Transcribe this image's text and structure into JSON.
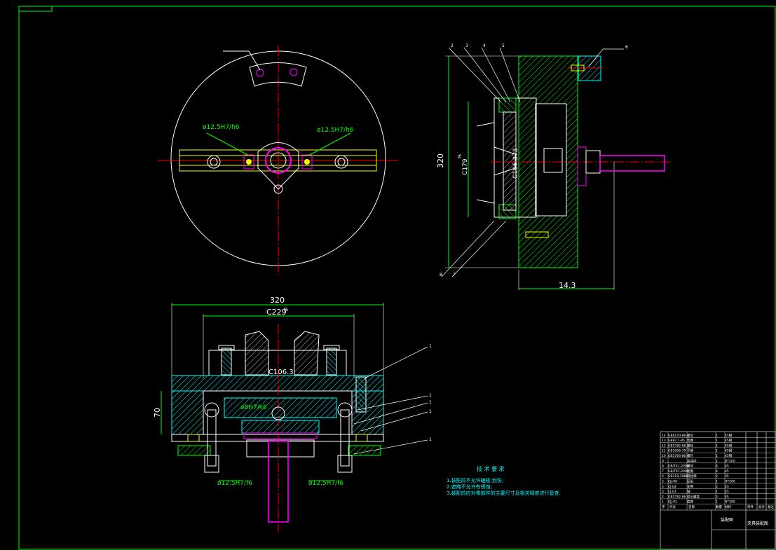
{
  "drawing": {
    "top_view": {
      "fit_left": "ø12.5H7/h6",
      "fit_right": "ø12.5H7/h6"
    },
    "side_view": {
      "overall_height": "320",
      "depth": "14.3",
      "dim_c179": "C179",
      "dim_c179_sub": "f6",
      "dim_c106": "C106.373",
      "balloons": [
        "2",
        "3",
        "4",
        "5",
        "6",
        "7",
        "8"
      ]
    },
    "front_view": {
      "overall_width": "320",
      "dim_c229": "C229",
      "dim_c229_sub": "f6",
      "dim_c106": "C106.3",
      "height": "70",
      "fit_center": "ø8H7/k6",
      "fit_left": "ø12.5H7/f6",
      "fit_right": "ø12.5H7/f6",
      "balloons": [
        "1",
        "1",
        "1",
        "1",
        "1"
      ]
    },
    "tech_requirements": {
      "title": "技 术 要 求",
      "items": [
        "1.装配前不允许磕碰,划伤;",
        "2.遮掩不允许有锈蚀;",
        "3.装配前应对零部件的主要尺寸及相关精度进行复查."
      ]
    },
    "title_block": {
      "drawing_name": "装配图",
      "part_name": "夹具装配图",
      "header": [
        "序",
        "代号",
        "名称",
        "数量",
        "材料",
        "单件",
        "总计",
        "备注"
      ],
      "rows": [
        {
          "no": "14",
          "code": "GB6170-86",
          "name": "螺母",
          "qty": "1",
          "mat": "45钢"
        },
        {
          "no": "13",
          "code": "GB97.1-85",
          "name": "垫圈",
          "qty": "1",
          "mat": "45钢"
        },
        {
          "no": "12",
          "code": "GB5782-86",
          "name": "螺栓",
          "qty": "1",
          "mat": "45钢"
        },
        {
          "no": "11",
          "code": "GB1096-79",
          "name": "平键",
          "qty": "1",
          "mat": "45钢"
        },
        {
          "no": "10",
          "code": "GB5783-86",
          "name": "螺钉",
          "qty": "1",
          "mat": "45钢"
        },
        {
          "no": "9",
          "code": "",
          "name": "夹具体",
          "qty": "1",
          "mat": "HT200"
        },
        {
          "no": "8",
          "code": "GB/T41-2000",
          "name": "螺母",
          "qty": "4",
          "mat": "45"
        },
        {
          "no": "7",
          "code": "GB/T97-2000",
          "name": "垫圈",
          "qty": "4",
          "mat": "45"
        },
        {
          "no": "6",
          "code": "GB119-1986",
          "name": "圆柱销",
          "qty": "2",
          "mat": "35"
        },
        {
          "no": "5",
          "code": "CJJ-06",
          "name": "压板",
          "qty": "1",
          "mat": "HT200"
        },
        {
          "no": "4",
          "code": "CJ-04",
          "name": "支撑",
          "qty": "2",
          "mat": "45"
        },
        {
          "no": "3",
          "code": "CJ-03",
          "name": "轴",
          "qty": "1",
          "mat": "45"
        },
        {
          "no": "2",
          "code": "GB5782-86",
          "name": "双头螺柱",
          "qty": "2",
          "mat": "45"
        },
        {
          "no": "1",
          "code": "CJJ-01",
          "name": "底座",
          "qty": "1",
          "mat": "HT200"
        }
      ]
    }
  },
  "colors": {
    "frame": "#00ff00",
    "outline": "#ffffff",
    "center": "#ff0000",
    "hatch": "#00ffff",
    "part": "#ffff00",
    "pin": "#ff00ff",
    "dimension": "#00ff00"
  }
}
